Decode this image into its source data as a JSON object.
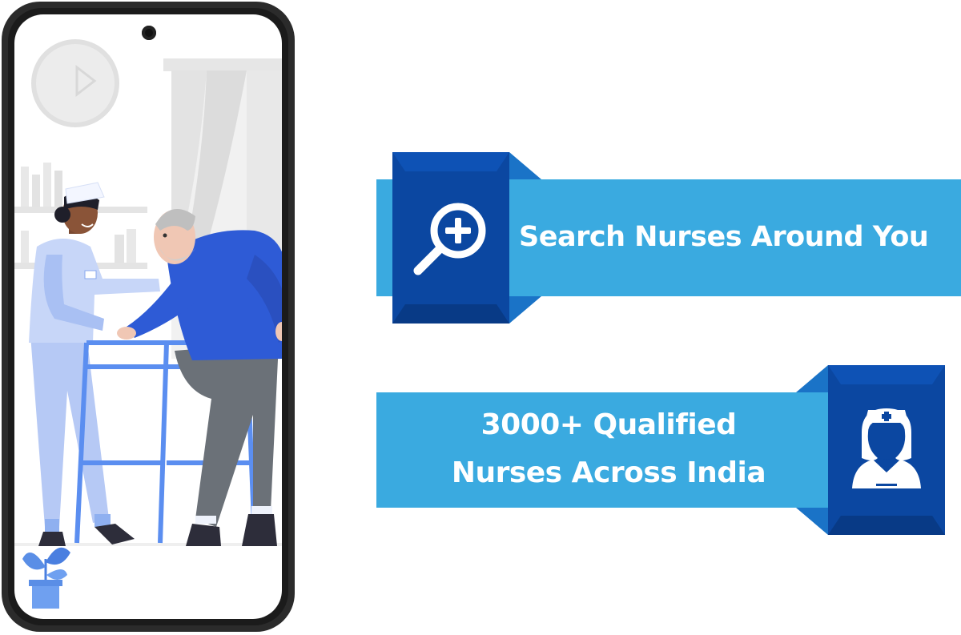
{
  "banner_search": {
    "label": "Search Nurses Around You",
    "icon": "search-plus-icon"
  },
  "banner_nurses": {
    "line1": "3000+ Qualified",
    "line2": "Nurses Across India",
    "icon": "nurse-icon"
  },
  "phone_illustration": {
    "icon": "nurse-helping-elderly-illustration"
  },
  "colors": {
    "banner_light_blue": "#3aaae0",
    "banner_dark_blue": "#0b47a1",
    "banner_mid_blue": "#1a73c7",
    "phone_frame": "#2b2b2b"
  }
}
